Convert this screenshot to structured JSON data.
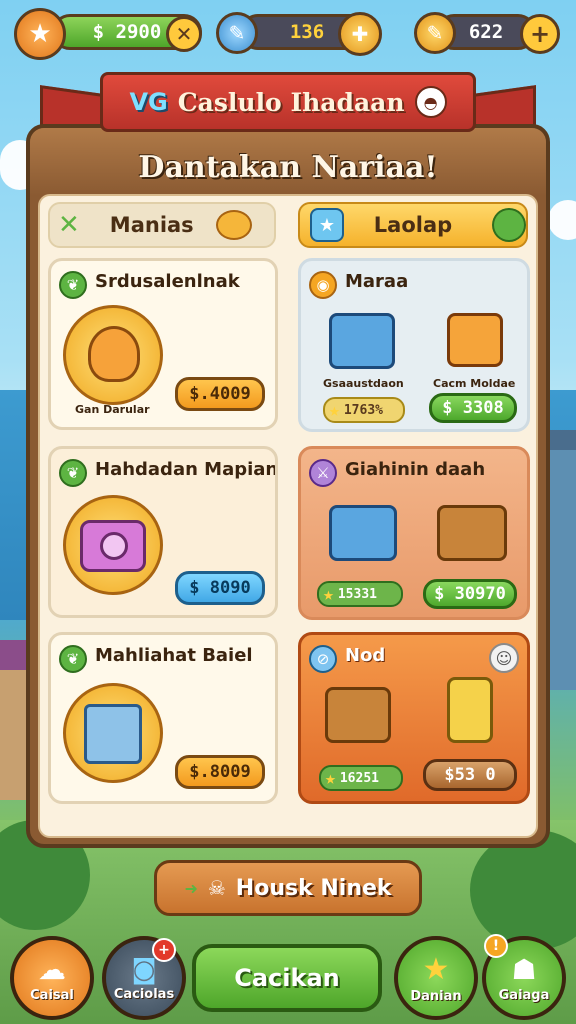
{
  "topbar": {
    "coins": "$ 2900",
    "gems": "136",
    "energy": "622"
  },
  "banner": {
    "badge": "VG",
    "title": "Caslulo Ihadaan"
  },
  "panel": {
    "title": "Dantakan Nariaa!"
  },
  "tabs": {
    "left": "Manias",
    "right": "Laolap"
  },
  "cards": {
    "c1": {
      "title": "Srdusalenlnak",
      "caption": "Gan Darular",
      "price": "$.4009"
    },
    "c2": {
      "title": "Hahdadan Mapian.",
      "price": "$ 8090"
    },
    "c3": {
      "title": "Mahliahat Baiel",
      "price": "$.8009"
    },
    "r1": {
      "title": "Maraa",
      "item1": "Gsaaustdaon",
      "item2": "Cacm Moldae",
      "stars": "1763%",
      "price": "$ 3308"
    },
    "r2": {
      "title": "Giahinin daah",
      "stars": "15331",
      "price": "$ 30970"
    },
    "r3": {
      "title": "Nod",
      "stars": "16251",
      "price": "$53 0"
    }
  },
  "mid_button": {
    "label": "Housk Ninek"
  },
  "nav": {
    "n1": "Caisal",
    "n2": "Caciolas",
    "main": "Cacikan",
    "n4": "Danian",
    "n5": "Gaiaga"
  },
  "colors": {
    "panel_wood": "#8a5a32",
    "ribbon_red": "#c8392c",
    "accent_orange": "#f39a1e",
    "accent_green": "#4da82c",
    "accent_blue": "#41a8e6"
  }
}
